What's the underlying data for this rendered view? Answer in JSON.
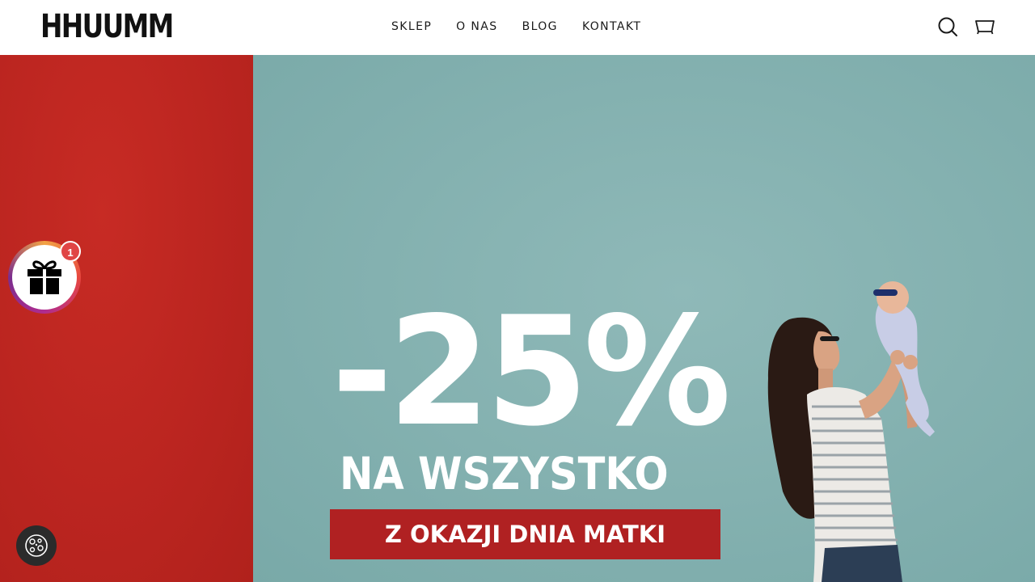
{
  "header": {
    "logo": "HHUUMM",
    "nav": [
      {
        "label": "SKLEP"
      },
      {
        "label": "O NAS"
      },
      {
        "label": "BLOG"
      },
      {
        "label": "KONTAKT"
      }
    ],
    "icons": {
      "search": "search-icon",
      "cart": "cart-icon"
    }
  },
  "hero": {
    "discount": "-25%",
    "subtitle": "NA WSZYSTKO",
    "banner": "Z OKAZJI DNIA MATKI",
    "colors": {
      "left_panel": "#bb2520",
      "right_panel": "#84b1b0",
      "banner": "#b02122",
      "text": "#ffffff"
    }
  },
  "widgets": {
    "gift_badge_count": "1",
    "gift_icon": "gift-icon",
    "cookie_icon": "cookie-icon"
  }
}
